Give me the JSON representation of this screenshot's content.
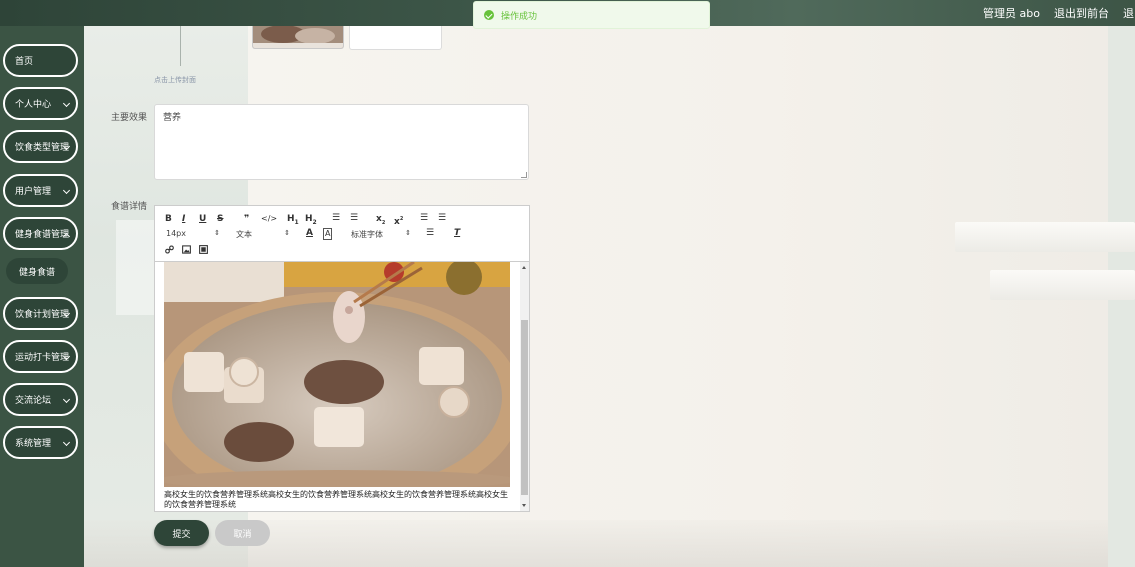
{
  "header": {
    "user_label": "管理员 abo",
    "front_link": "退出到前台",
    "logout_link": "退出登录"
  },
  "toast": {
    "message": "操作成功"
  },
  "sidebar": {
    "items": [
      {
        "label": "首页"
      },
      {
        "label": "个人中心"
      },
      {
        "label": "饮食类型管理"
      },
      {
        "label": "用户管理"
      },
      {
        "label": "健身食谱管理"
      },
      {
        "label": "饮食计划管理"
      },
      {
        "label": "运动打卡管理"
      },
      {
        "label": "交流论坛"
      },
      {
        "label": "系统管理"
      }
    ],
    "sub_item": "健身食谱"
  },
  "form": {
    "cover_hint": "点击上传封面",
    "effect_label": "主要效果",
    "effect_value": "营养",
    "detail_label": "食谱详情",
    "editor": {
      "font_size": "14px",
      "text_type": "文本",
      "font_family": "标准字体",
      "description": "高校女生的饮食营养管理系统高校女生的饮食营养管理系统高校女生的饮食营养管理系统高校女生的饮食营养管理系统"
    },
    "submit_label": "提交",
    "cancel_label": "取消"
  },
  "colors": {
    "sidebar_bg": "#3b5444",
    "button_dark": "#2e4538",
    "toast_green": "#67c23a"
  }
}
